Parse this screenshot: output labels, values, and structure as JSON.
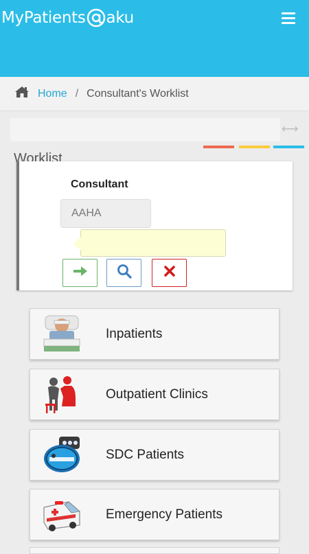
{
  "header": {
    "brand_left": "MyPatients",
    "brand_right": "aku",
    "menu_icon": "hamburger-menu-icon",
    "color": "#2bbde8"
  },
  "breadcrumb": {
    "home_icon": "home-icon",
    "home": "Home",
    "separator": "/",
    "current": "Consultant's Worklist"
  },
  "color_bars": [
    "#ee6a4f",
    "#f9cc3d",
    "#2bbde8"
  ],
  "worklist": {
    "title": "Worklist",
    "field_label": "Consultant",
    "field_value": "AAHA",
    "buttons": {
      "go_icon": "arrow-right-icon",
      "search_icon": "search-icon",
      "clear_icon": "close-icon"
    }
  },
  "menu": [
    {
      "label": "Inpatients",
      "icon": "inpatient-bed-icon"
    },
    {
      "label": "Outpatient Clinics",
      "icon": "outpatient-clinic-icon"
    },
    {
      "label": "SDC Patients",
      "icon": "sdc-patients-icon"
    },
    {
      "label": "Emergency Patients",
      "icon": "ambulance-icon"
    }
  ]
}
